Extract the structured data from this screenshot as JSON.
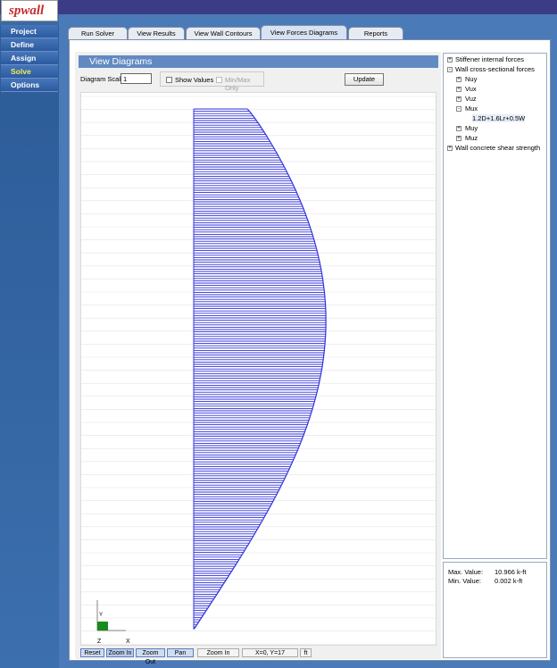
{
  "app": {
    "logo_prefix": "sp",
    "logo_name": "wall"
  },
  "sidebar": {
    "items": [
      {
        "label": "Project"
      },
      {
        "label": "Define"
      },
      {
        "label": "Assign"
      },
      {
        "label": "Solve"
      },
      {
        "label": "Options"
      }
    ],
    "active_item": "Solve"
  },
  "tabs": [
    {
      "label": "Run Solver"
    },
    {
      "label": "View Results"
    },
    {
      "label": "View Wall Contours"
    },
    {
      "label": "View Forces Diagrams"
    },
    {
      "label": "Reports"
    }
  ],
  "active_tab": "View Forces Diagrams",
  "panel": {
    "title": "View Diagrams",
    "scale_label": "Diagram Scale:",
    "scale_value": "1",
    "show_values_label": "Show Values",
    "show_values_checked": false,
    "minmax_label": "Min/Max Only",
    "minmax_enabled": false,
    "update_label": "Update"
  },
  "tree": {
    "nodes": [
      {
        "label": "Stiffener internal forces",
        "expander": "+",
        "level": 0
      },
      {
        "label": "Wall cross-sectional forces",
        "expander": "-",
        "level": 0
      },
      {
        "label": "Nuy",
        "expander": "+",
        "level": 1
      },
      {
        "label": "Vux",
        "expander": "+",
        "level": 1
      },
      {
        "label": "Vuz",
        "expander": "+",
        "level": 1
      },
      {
        "label": "Mux",
        "expander": "-",
        "level": 1
      },
      {
        "label": "1.2D+1.6Lr+0.5W",
        "expander": "",
        "level": 2
      },
      {
        "label": "Muy",
        "expander": "+",
        "level": 1
      },
      {
        "label": "Muz",
        "expander": "+",
        "level": 1
      },
      {
        "label": "Wall concrete shear strength",
        "expander": "+",
        "level": 0
      }
    ]
  },
  "values": {
    "max_label": "Max. Value:",
    "max_value": "10.966 k-ft",
    "min_label": "Min. Value:",
    "min_value": "0.002 k-ft"
  },
  "axes_icon": {
    "y_label": "Y",
    "z_label": "Z",
    "x_label": "X"
  },
  "statusbar": {
    "reset": "Reset",
    "zoom_in": "Zoom In",
    "zoom_out": "Zoom Out",
    "pan": "Pan",
    "mode": "Zoom In",
    "coords": "X=0, Y=17",
    "units": "ft"
  },
  "diagram": {
    "color": "#3333dd",
    "max_value_kft": 10.966,
    "min_value_kft": 0.002
  }
}
